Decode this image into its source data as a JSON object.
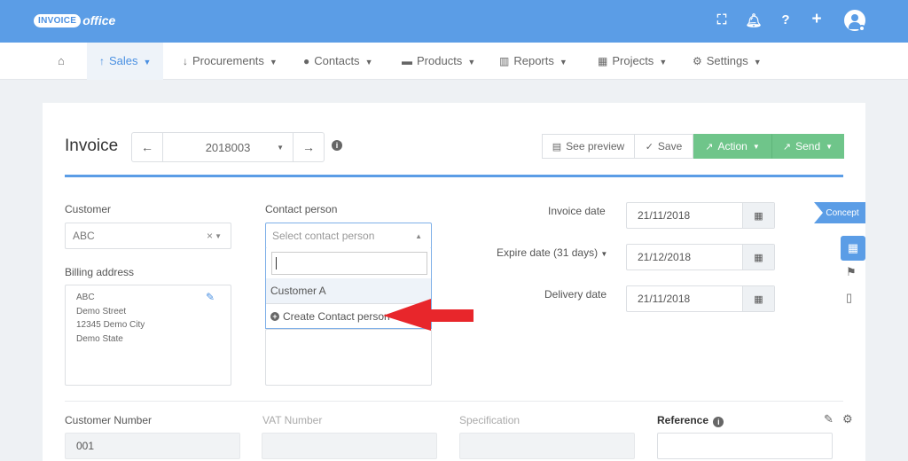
{
  "app": {
    "logo_badge": "INVOICE",
    "logo_text": "office"
  },
  "topbar": {
    "icons": [
      "fullscreen-icon",
      "bell-icon",
      "help-icon",
      "plus-icon",
      "user-avatar-icon"
    ],
    "help_glyph": "?",
    "plus_glyph": "+"
  },
  "nav": {
    "home_icon": "home-icon",
    "items": [
      {
        "label": "Sales",
        "active": true
      },
      {
        "label": "Procurements"
      },
      {
        "label": "Contacts"
      },
      {
        "label": "Products"
      },
      {
        "label": "Reports"
      },
      {
        "label": "Projects"
      },
      {
        "label": "Settings"
      }
    ]
  },
  "invoice": {
    "title": "Invoice",
    "number": "2018003",
    "actions": {
      "preview": "See preview",
      "save": "Save",
      "action": "Action",
      "send": "Send"
    }
  },
  "form": {
    "customer": {
      "label": "Customer",
      "value": "ABC"
    },
    "billing": {
      "label": "Billing address",
      "lines": [
        "ABC",
        "Demo Street",
        "12345 Demo City",
        "Demo State"
      ]
    },
    "contact": {
      "label": "Contact person",
      "placeholder": "Select contact person",
      "search_value": "",
      "options": [
        "Customer A"
      ],
      "create_label": "Create Contact person"
    },
    "invoice_date": {
      "label": "Invoice date",
      "value": "21/11/2018"
    },
    "expire_date": {
      "label": "Expire date (31 days)",
      "value": "21/12/2018"
    },
    "delivery_date": {
      "label": "Delivery date",
      "value": "21/11/2018"
    },
    "status_ribbon": "Concept",
    "customer_number": {
      "label": "Customer Number",
      "value": "001"
    },
    "vat_number": {
      "label": "VAT Number",
      "value": ""
    },
    "specification": {
      "label": "Specification",
      "value": ""
    },
    "reference": {
      "label": "Reference",
      "value": ""
    }
  },
  "colors": {
    "primary": "#5b9de6",
    "success": "#6fc58a",
    "annotation_arrow": "#e8262b"
  }
}
